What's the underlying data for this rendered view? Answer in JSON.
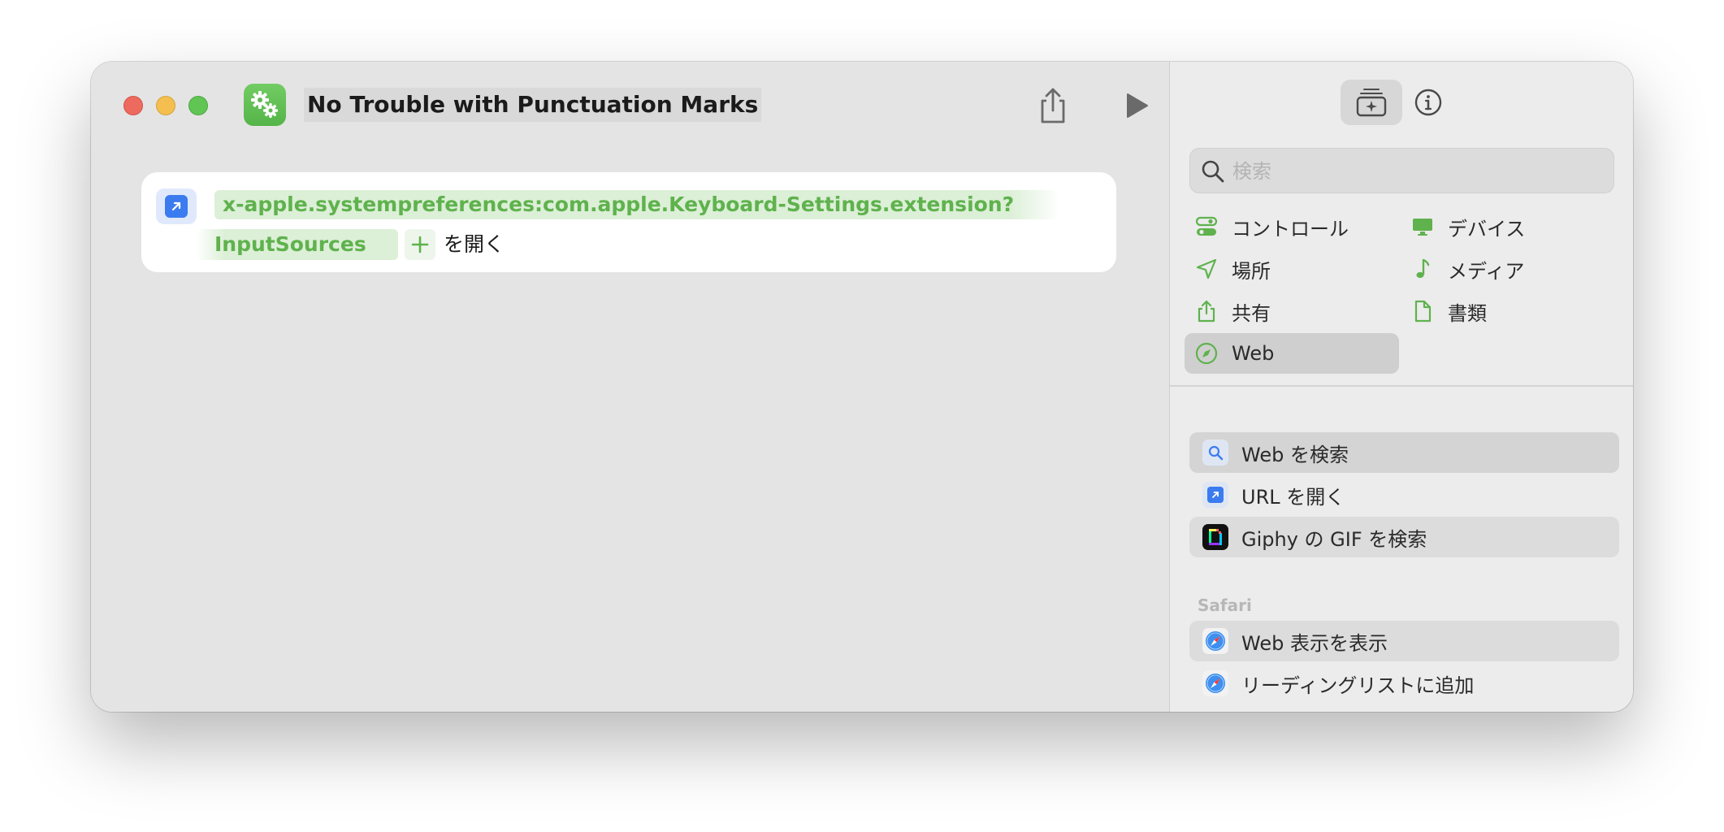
{
  "window": {
    "title": "No Trouble with Punctuation Marks"
  },
  "action": {
    "url_part1": "x-apple.systempreferences:com.apple.Keyboard-Settings.extension?",
    "url_part2": "InputSources",
    "suffix": "を開く"
  },
  "sidebar": {
    "search_placeholder": "検索",
    "categories": [
      {
        "label": "コントロール",
        "icon": "toggle-icon"
      },
      {
        "label": "デバイス",
        "icon": "display-icon"
      },
      {
        "label": "場所",
        "icon": "location-arrow-icon"
      },
      {
        "label": "メディア",
        "icon": "music-note-icon"
      },
      {
        "label": "共有",
        "icon": "share-icon"
      },
      {
        "label": "書類",
        "icon": "document-icon"
      },
      {
        "label": "Web",
        "icon": "compass-icon"
      }
    ],
    "actions": [
      {
        "label": "Web を検索",
        "icon": "magnifier-icon"
      },
      {
        "label": "URL を開く",
        "icon": "open-url-icon"
      },
      {
        "label": "Giphy の GIF を検索",
        "icon": "giphy-icon"
      }
    ],
    "section_safari": "Safari",
    "safari_actions": [
      {
        "label": "Web 表示を表示",
        "icon": "safari-icon"
      },
      {
        "label": "リーディングリストに追加",
        "icon": "safari-icon"
      }
    ]
  },
  "colors": {
    "accent_green": "#5fb24d",
    "url_blue": "#3b7bf0",
    "close": "#ed6a5e",
    "minimize": "#f4bf4f",
    "zoom": "#61c554"
  }
}
